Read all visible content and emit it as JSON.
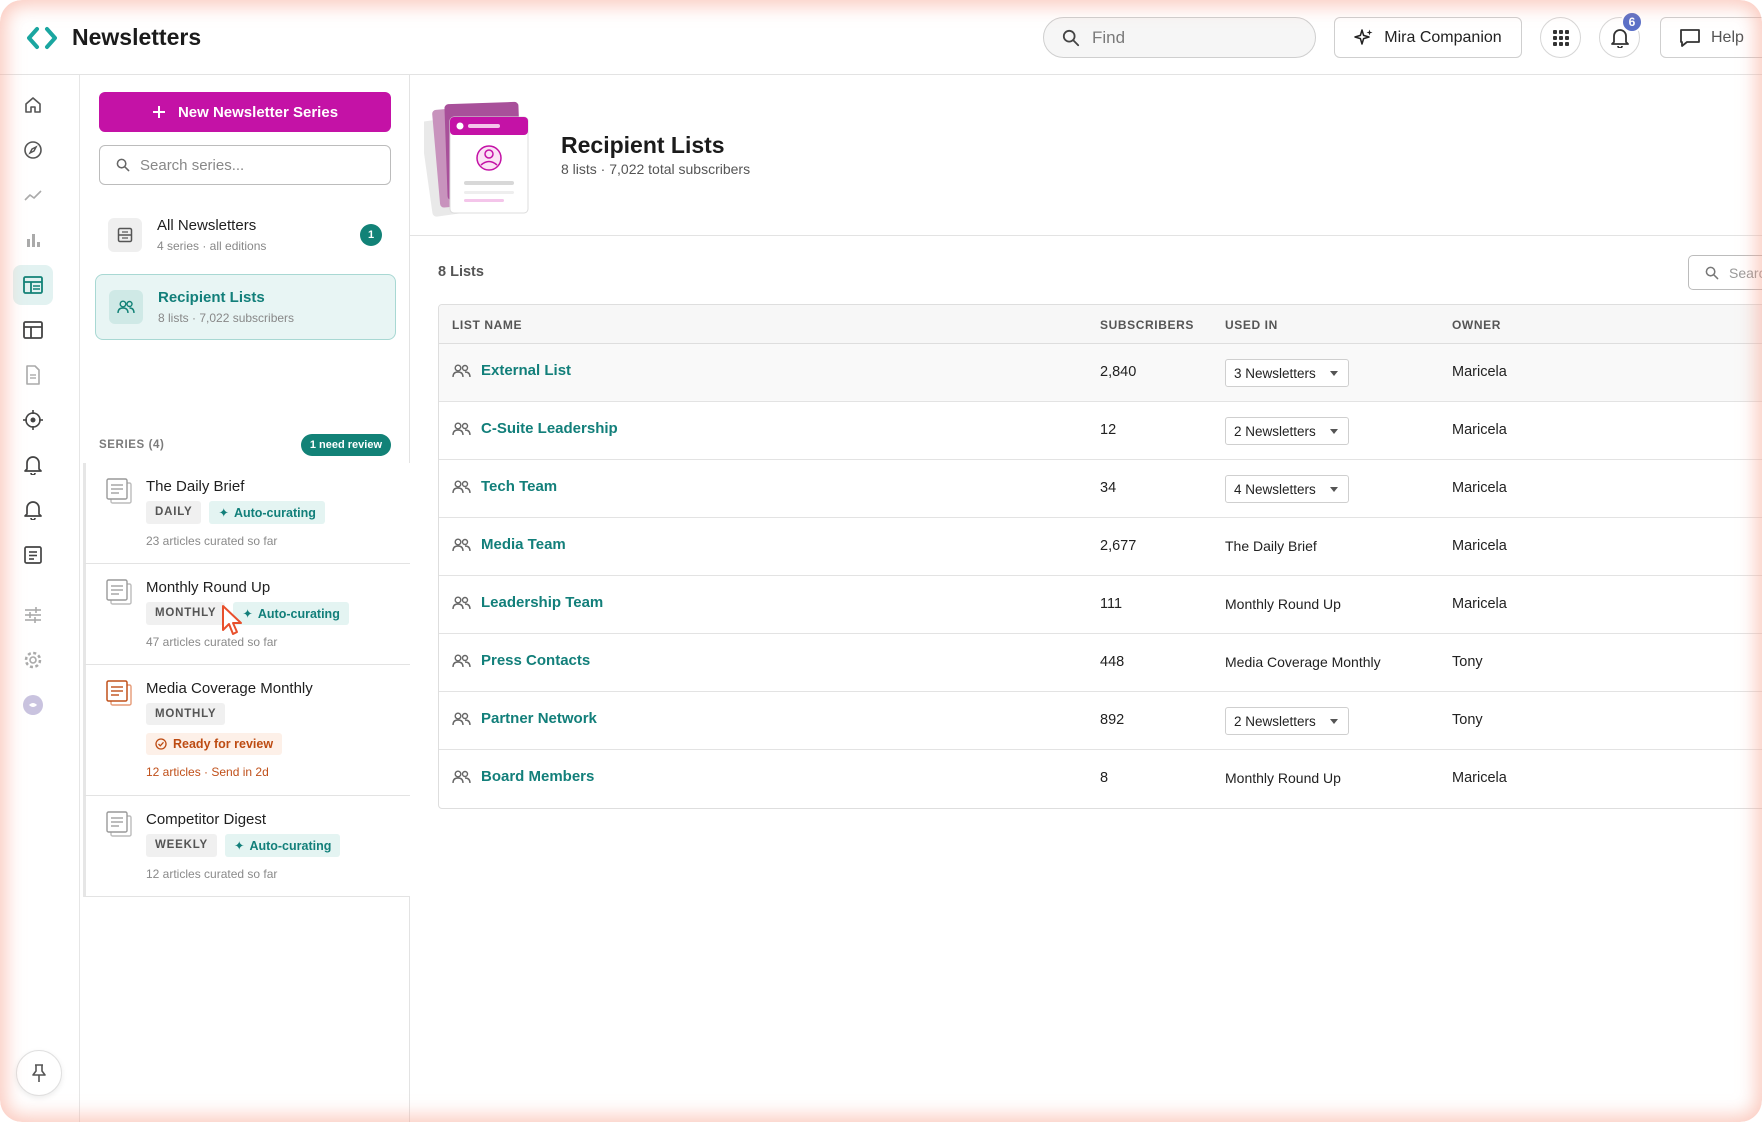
{
  "app": {
    "title": "Newsletters"
  },
  "topbar": {
    "find_placeholder": "Find",
    "companion_label": "Mira Companion",
    "notification_count": "6",
    "help_label": "Help"
  },
  "series_panel": {
    "new_button_label": "New Newsletter Series",
    "search_placeholder": "Search series...",
    "nav": [
      {
        "title": "All Newsletters",
        "sub": "4 series · all editions",
        "count": "1"
      },
      {
        "title": "Recipient Lists",
        "sub": "8 lists · 7,022 subscribers"
      }
    ],
    "series_label": "SERIES (4)",
    "review_label": "1 need review",
    "series": [
      {
        "title": "The Daily Brief",
        "freq": "DAILY",
        "status": "Auto-curating",
        "meta": "23 articles curated so far"
      },
      {
        "title": "Monthly Round Up",
        "freq": "MONTHLY",
        "status": "Auto-curating",
        "meta": "47 articles curated so far"
      },
      {
        "title": "Media Coverage Monthly",
        "freq": "MONTHLY",
        "status": "Ready for review",
        "meta": "12 articles · Send in 2d"
      },
      {
        "title": "Competitor Digest",
        "freq": "WEEKLY",
        "status": "Auto-curating",
        "meta": "12 articles curated so far"
      }
    ]
  },
  "main": {
    "title": "Recipient Lists",
    "subtitle": "8 lists · 7,022 total subscribers",
    "lists_count": "8 Lists",
    "search_placeholder": "Search",
    "columns": {
      "name": "LIST NAME",
      "subscribers": "SUBSCRIBERS",
      "used_in": "USED IN",
      "owner": "OWNER"
    },
    "rows": [
      {
        "name": "External List",
        "subscribers": "2,840",
        "used_in": "3 Newsletters",
        "dropdown": true,
        "owner": "Maricela"
      },
      {
        "name": "C-Suite Leadership",
        "subscribers": "12",
        "used_in": "2 Newsletters",
        "dropdown": true,
        "owner": "Maricela"
      },
      {
        "name": "Tech Team",
        "subscribers": "34",
        "used_in": "4 Newsletters",
        "dropdown": true,
        "owner": "Maricela"
      },
      {
        "name": "Media Team",
        "subscribers": "2,677",
        "used_in": "The Daily Brief",
        "dropdown": false,
        "owner": "Maricela"
      },
      {
        "name": "Leadership Team",
        "subscribers": "111",
        "used_in": "Monthly Round Up",
        "dropdown": false,
        "owner": "Maricela"
      },
      {
        "name": "Press Contacts",
        "subscribers": "448",
        "used_in": "Media Coverage Monthly",
        "dropdown": false,
        "owner": "Tony"
      },
      {
        "name": "Partner Network",
        "subscribers": "892",
        "used_in": "2 Newsletters",
        "dropdown": true,
        "owner": "Tony"
      },
      {
        "name": "Board Members",
        "subscribers": "8",
        "used_in": "Monthly Round Up",
        "dropdown": false,
        "owner": "Maricela"
      }
    ]
  },
  "colors": {
    "accent": "#c412a6",
    "teal": "#127f7a",
    "warning": "#bd4b12"
  }
}
